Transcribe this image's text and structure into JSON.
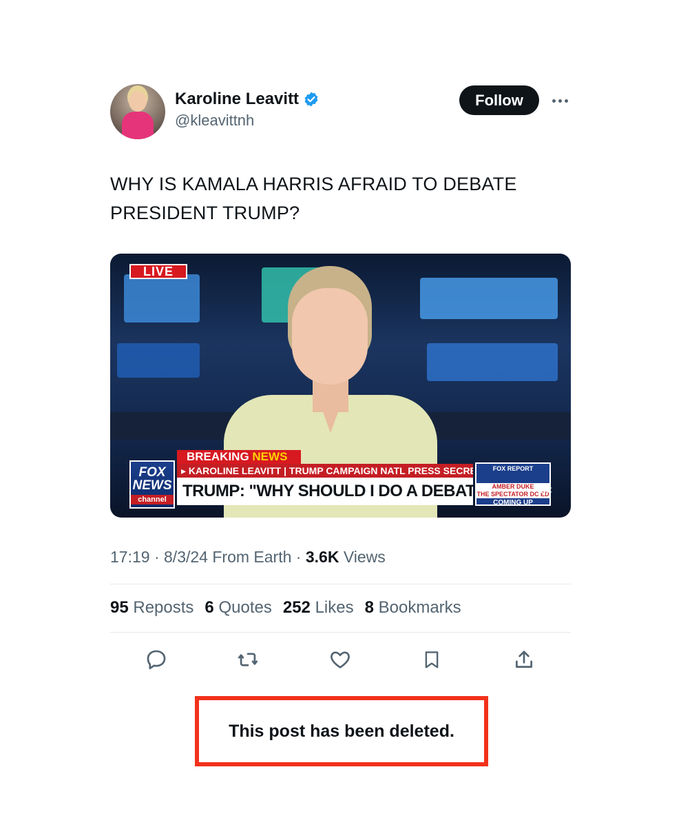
{
  "author": {
    "display_name": "Karoline Leavitt",
    "handle": "@kleavittnh",
    "verified": true,
    "verified_color": "#1d9bf0"
  },
  "follow_label": "Follow",
  "tweet_text_line1": "WHY IS KAMALA HARRIS AFRAID TO DEBATE",
  "tweet_text_line2": "PRESIDENT TRUMP?",
  "media": {
    "live_label": "LIVE",
    "logo_line1": "FOX",
    "logo_line2": "NEWS",
    "logo_line3": "channel",
    "breaking_label": "BREAKING",
    "news_label": "NEWS",
    "strap_text": "▸ KAROLINE LEAVITT | TRUMP CAMPAIGN NATL PRESS SECRETARY",
    "headline": "TRUMP: \"WHY SHOULD I DO A DEBATE?\"",
    "promo_top": "FOX REPORT",
    "promo_name_1": "AMBER DUKE",
    "promo_name_2": "THE SPECTATOR DC ED",
    "promo_coming": "COMING UP"
  },
  "meta": {
    "time": "17:19",
    "date": "8/3/24",
    "location": "From Earth",
    "views_count": "3.6K",
    "views_label": "Views"
  },
  "stats": [
    {
      "count": "95",
      "label": "Reposts"
    },
    {
      "count": "6",
      "label": "Quotes"
    },
    {
      "count": "252",
      "label": "Likes"
    },
    {
      "count": "8",
      "label": "Bookmarks"
    }
  ],
  "actions": [
    "reply-icon",
    "repost-icon",
    "like-icon",
    "bookmark-icon",
    "share-icon"
  ],
  "deleted_notice": "This post has been deleted.",
  "colors": {
    "text": "#0f1419",
    "secondary": "#536471",
    "highlight_box": "#f2311b"
  }
}
